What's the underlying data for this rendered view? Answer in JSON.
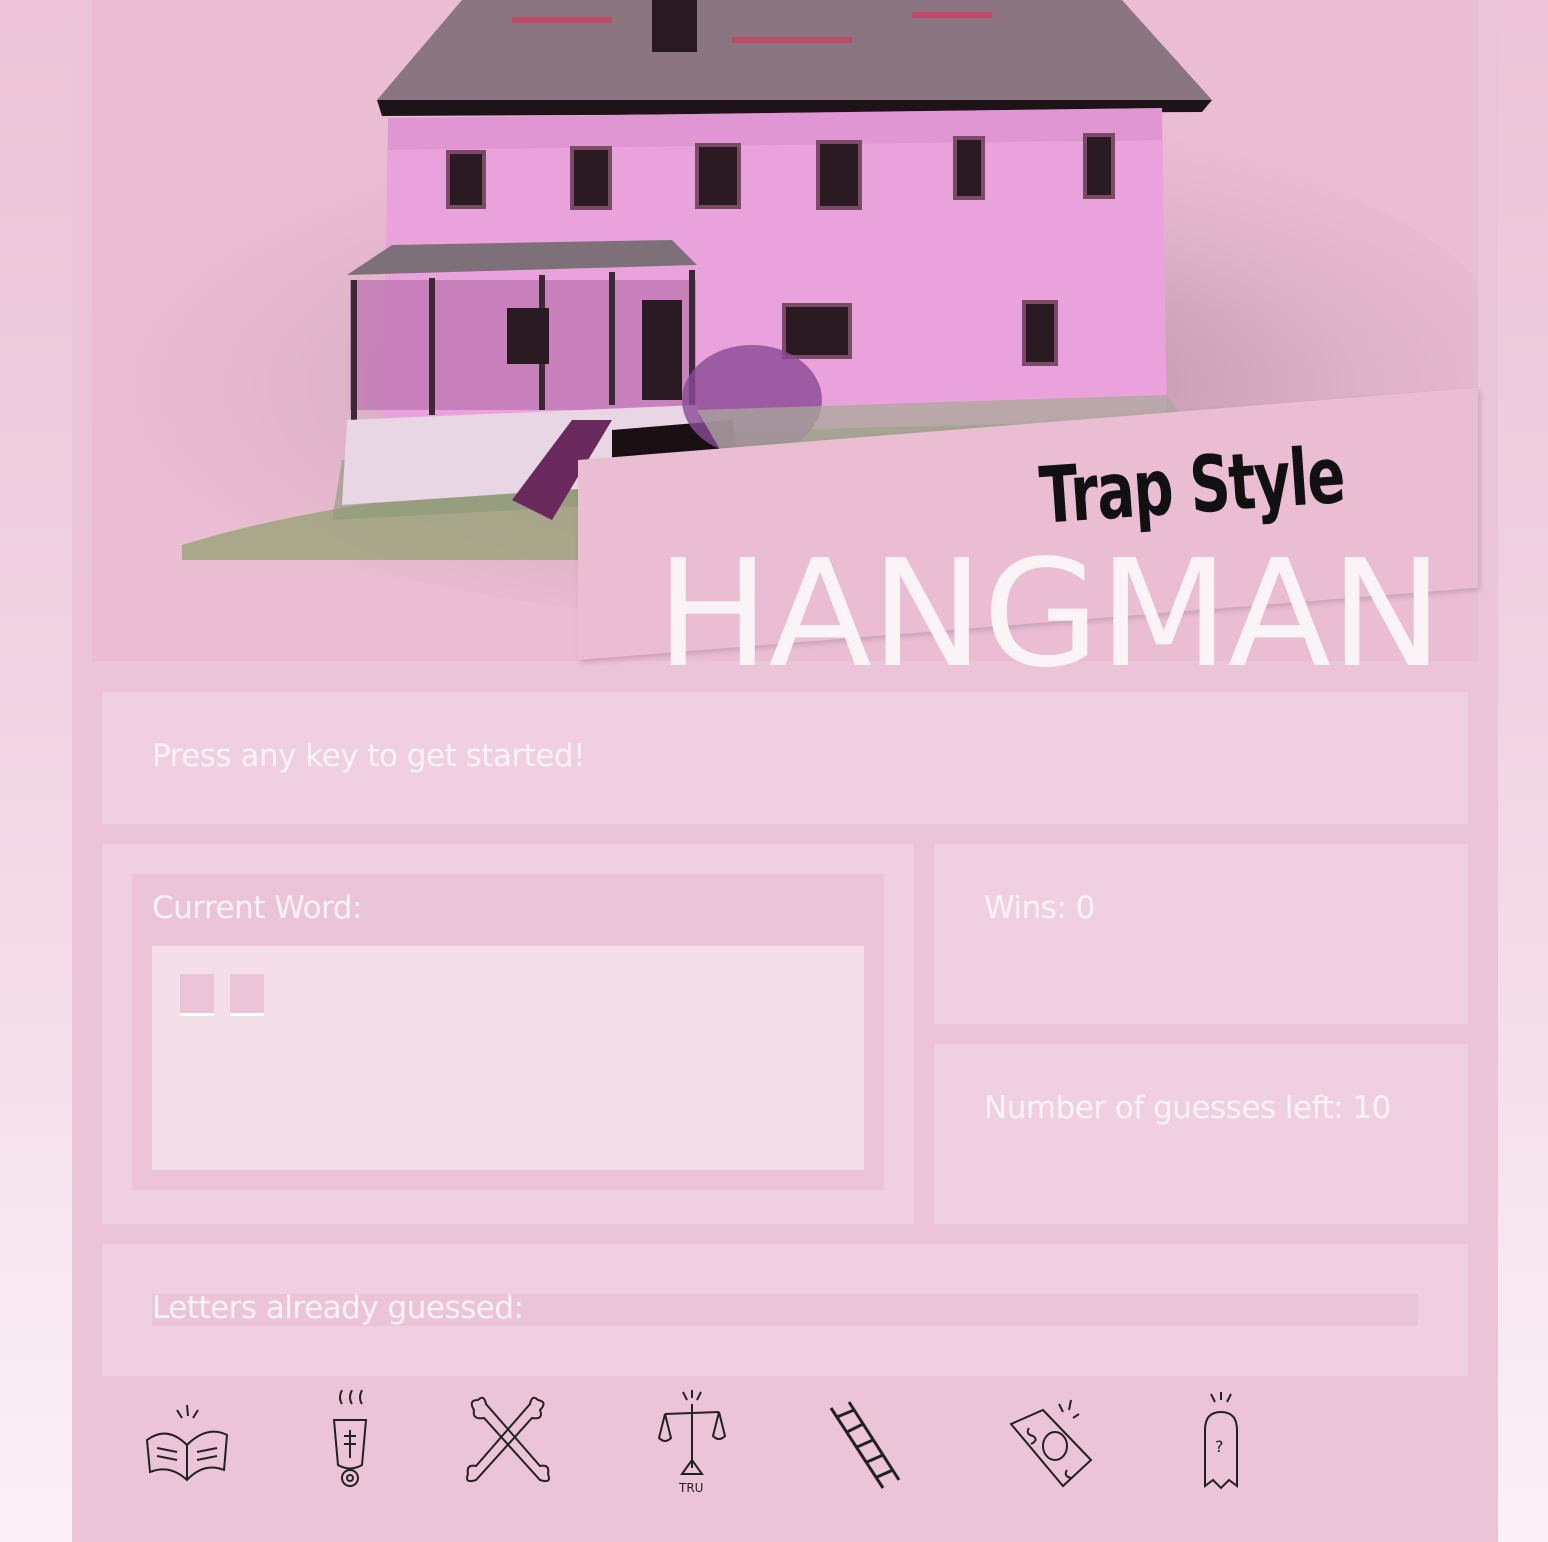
{
  "banner": {
    "title_small": "Trap Style",
    "title_large": "HANGMAN"
  },
  "status": {
    "message": "Press any key to get started!"
  },
  "word": {
    "label": "Current Word:",
    "slots": [
      "",
      ""
    ]
  },
  "stats": {
    "wins": "Wins: 0",
    "guesses_left": "Number of guesses left: 10"
  },
  "guessed": {
    "label": "Letters already guessed:",
    "letters": ""
  },
  "footer": {
    "scale_label": "TRU"
  },
  "icons": [
    "book-icon",
    "hot-cup-icon",
    "crossbones-icon",
    "scales-icon",
    "ladder-icon",
    "money-icon",
    "ghost-icon"
  ],
  "colors": {
    "background": "#ecc4d7",
    "panel": "#f0d0e0",
    "text": "#fbf3f7",
    "title_dark": "#111111"
  }
}
